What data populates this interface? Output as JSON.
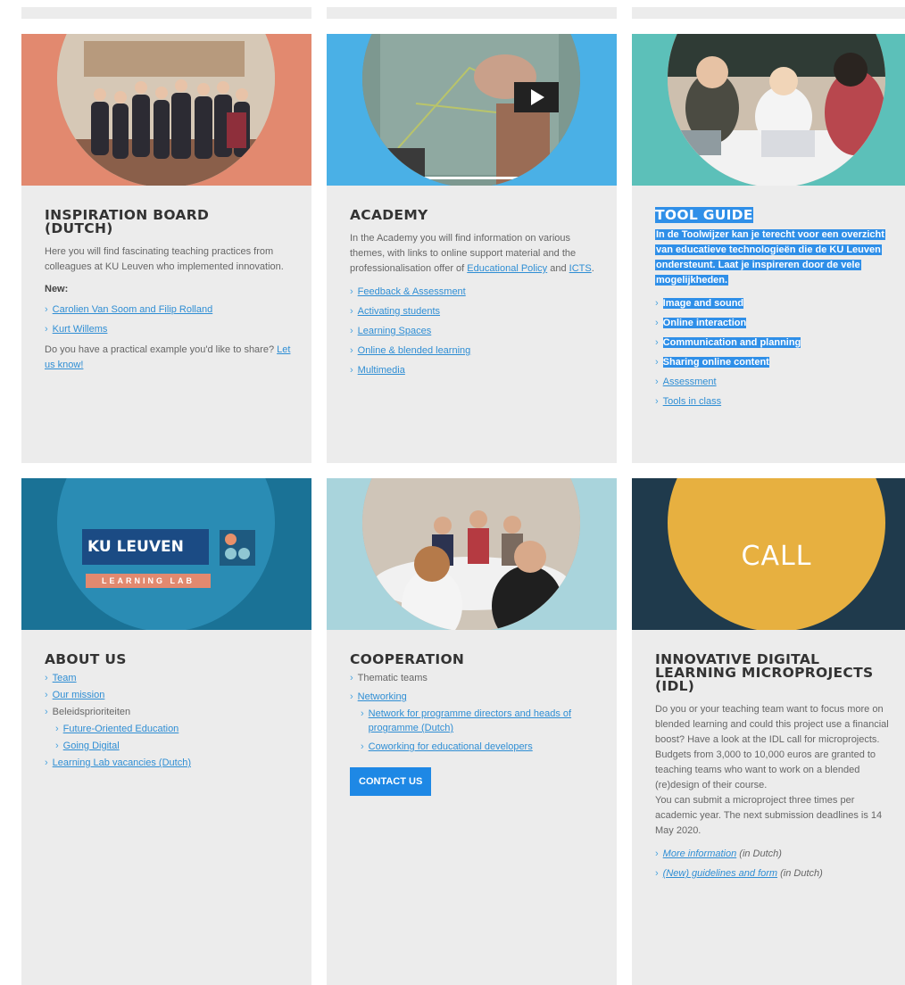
{
  "colors": {
    "link": "#2f8ed4",
    "highlight": "#2f8fe8",
    "card_bg": "#ececec",
    "button": "#1e88e5"
  },
  "inspiration": {
    "title": "INSPIRATION BOARD (DUTCH)",
    "intro": "Here you will find fascinating teaching practices from colleagues at KU Leuven who implemented innovation.",
    "new_label": "New:",
    "links": [
      "Carolien Van Soom and Filip Rolland",
      "Kurt Willems"
    ],
    "cta_text": "Do you have a practical example you'd like to share?",
    "cta_link": "Let us know!"
  },
  "academy": {
    "title": "ACADEMY",
    "intro": "In the Academy you will find information on various themes, with links to online support material and the professionalisation offer of",
    "link_policy": "Educational Policy",
    "and": "and",
    "link_icts": "ICTS",
    "links": [
      "Feedback & Assessment",
      "Activating students",
      "Learning Spaces",
      "Online & blended learning",
      "Multimedia"
    ],
    "video_icon": "play-icon"
  },
  "tool_guide": {
    "title": "TOOL GUIDE",
    "intro": "In de Toolwijzer kan je terecht voor een overzicht van educatieve technologieën die de KU Leuven ondersteunt. Laat je inspireren door de vele mogelijkheden.",
    "highlighted_items": [
      "Image and sound",
      "Online interaction",
      "Communication and planning",
      "Sharing online content"
    ],
    "links": [
      "Assessment",
      "Tools in class"
    ]
  },
  "about": {
    "title": "ABOUT US",
    "logo_text": "KU LEUVEN",
    "logo_subtext": "LEARNING LAB",
    "items": [
      "Team",
      "Our mission"
    ],
    "plain_item": "Beleidsprioriteiten",
    "sub_items": [
      "Future-Oriented Education",
      "Going Digital"
    ],
    "last_item": "Learning Lab vacancies (Dutch)"
  },
  "cooperation": {
    "title": "COOPERATION",
    "plain_item": "Thematic teams",
    "networking": "Networking",
    "sub_items": [
      "Network for programme directors and heads of programme (Dutch)",
      "Coworking for educational developers"
    ],
    "button": "CONTACT US"
  },
  "idl": {
    "title": "INNOVATIVE DIGITAL LEARNING MICROPROJECTS (IDL)",
    "banner_text": "CALL",
    "para1": "Do you or your teaching team want to focus more on blended learning and could this project use a financial boost? Have a look at the IDL call for microprojects. Budgets from 3,000 to 10,000 euros are granted to teaching teams who want to work on a blended (re)design of their course.",
    "para2": "You can submit a microproject three times per academic year. The next submission deadlines is 14 May 2020.",
    "link1": "More information",
    "link1_suffix": "(in Dutch)",
    "link2": "(New) guidelines and form",
    "link2_suffix": "(in Dutch)"
  }
}
